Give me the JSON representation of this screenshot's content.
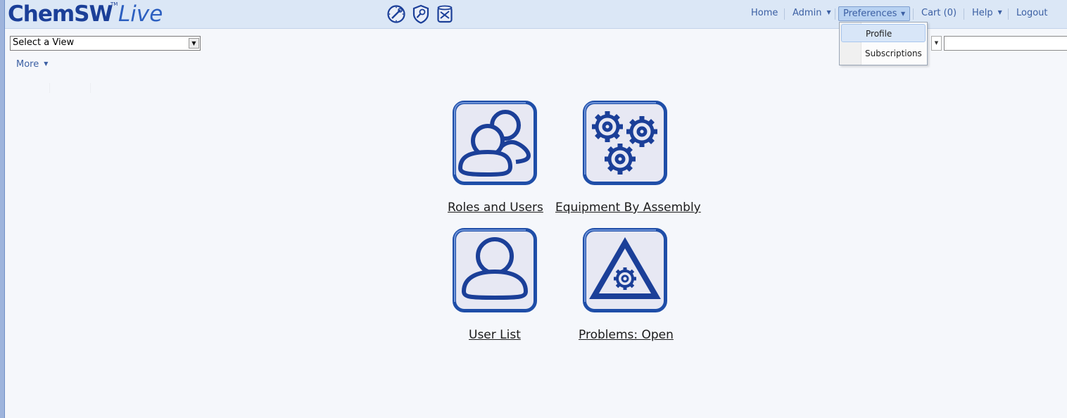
{
  "brand": {
    "name_main": "ChemSW",
    "name_sub": "Live",
    "tm": "TM"
  },
  "top_icons": [
    "compass-wrench-icon",
    "shield-wrench-icon",
    "container-tools-icon"
  ],
  "nav": {
    "home": "Home",
    "admin": "Admin",
    "preferences": "Preferences",
    "cart": "Cart (0)",
    "help": "Help",
    "logout": "Logout"
  },
  "preferences_menu": {
    "items": [
      "Profile",
      "Subscriptions"
    ],
    "highlighted": "Profile"
  },
  "view_select": {
    "selected": "Select a View"
  },
  "more_menu": {
    "label": "More"
  },
  "tiles": [
    {
      "label": "Roles and Users",
      "icon": "users-group-icon"
    },
    {
      "label": "Equipment By Assembly",
      "icon": "gears-icon"
    },
    {
      "label": "User List",
      "icon": "user-icon"
    },
    {
      "label": "Problems: Open",
      "icon": "warning-gear-icon"
    }
  ],
  "colors": {
    "accent": "#1b3f98",
    "tile_border": "#1f4ea8",
    "tile_fill": "#e7e8f3",
    "topbar": "#dbe7f6"
  }
}
